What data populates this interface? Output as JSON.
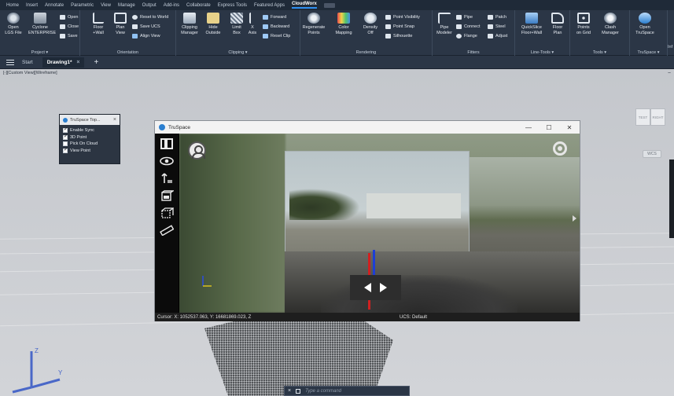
{
  "menubar": {
    "items": [
      "Home",
      "Insert",
      "Annotate",
      "Parametric",
      "View",
      "Manage",
      "Output",
      "Add-ins",
      "Collaborate",
      "Express Tools",
      "Featured Apps",
      "CloudWorx"
    ]
  },
  "ribbon": {
    "project": {
      "title": "Project",
      "open_lgs": "Open\nLGS File",
      "cyclone": "Cyclone\nENTERPRISE",
      "open": "Open",
      "close": "Close",
      "save": "Save"
    },
    "orientation": {
      "title": "Orientation",
      "floor": "Floor\n+Wall",
      "plan": "Plan\nView",
      "reset_world": "Reset to World",
      "save_ucs": "Save UCS",
      "align_view": "Align View"
    },
    "clipping": {
      "title": "Clipping",
      "manager": "Clipping\nManager",
      "hide_outside": "Hide\nOutside",
      "limit_box": "Limit\nBox",
      "x_axis": "X\nAxis",
      "forward": "Forward",
      "backward": "Backward",
      "reset_clip": "Reset Clip"
    },
    "rendering": {
      "title": "Rendering",
      "regenerate": "Regenerate\nPoints",
      "color_mapping": "Color\nMapping",
      "density": "Density\nOff",
      "point_visibility": "Point Visibility",
      "point_snap": "Point Snap",
      "silhouette": "Silhouette"
    },
    "fitters": {
      "title": "Fitters",
      "pipe_modeler": "Pipe\nModeler",
      "pipe": "Pipe",
      "connect": "Connect",
      "flange": "Flange",
      "patch": "Patch",
      "steel": "Steel",
      "adjust": "Adjust"
    },
    "line_tools": {
      "title": "Line-Tools",
      "quickslice": "QuickSlice\nFloor+Wall",
      "floor_plan": "Floor\nPlan"
    },
    "tools": {
      "title": "Tools",
      "points_on_grid": "Points\non Grid",
      "clash_manager": "Clash\nManager"
    },
    "truspace": {
      "title": "TruSpace",
      "open_truspace": "Open\nTruSpace"
    },
    "overflow": "Inf"
  },
  "tabbar": {
    "start": "Start",
    "drawing": "Drawing1*",
    "close": "×",
    "new": "+"
  },
  "viewport": {
    "label": "[-][Custom View][Wireframe]",
    "minimize": "−",
    "viewcube_left": "TEST",
    "viewcube_right": "RIGHT",
    "wcs": "WCS"
  },
  "sync_panel": {
    "title": "TruSpace Top...",
    "close": "×",
    "options": [
      {
        "label": "Enable Sync",
        "checked": true
      },
      {
        "label": "3D Point",
        "checked": true
      },
      {
        "label": "Pick On Cloud",
        "checked": false
      },
      {
        "label": "View Point",
        "checked": true
      }
    ]
  },
  "truspace": {
    "title": "TruSpace",
    "minimize": "—",
    "maximize": "☐",
    "close": "✕",
    "status_cursor": "Cursor: X: 1052537.063, Y: 16681869.023, Z",
    "status_ucs": "UCS: Default"
  },
  "cmdline": {
    "placeholder": "Type a command"
  },
  "colors": {
    "ribbon_bg": "#2b3646",
    "menubar_bg": "#1f2a38",
    "viewport_bg": "#c9ccd1",
    "accent": "#2f8ff0"
  }
}
